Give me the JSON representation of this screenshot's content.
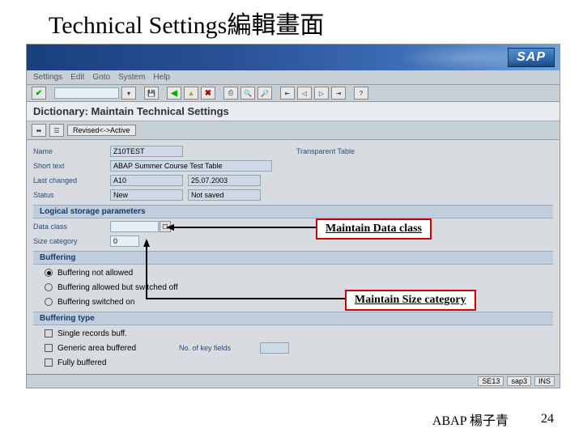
{
  "slide": {
    "title": "Technical Settings編輯畫面",
    "author": "ABAP 楊子青",
    "page": "24"
  },
  "sap": {
    "logo": "SAP",
    "menu": [
      "Settings",
      "Edit",
      "Goto",
      "System",
      "Help"
    ],
    "screen_title": "Dictionary: Maintain Technical Settings",
    "secondary": {
      "revised": "Revised<->Active"
    },
    "form": {
      "name_lbl": "Name",
      "name_val": "Z10TEST",
      "table_type": "Transparent Table",
      "short_lbl": "Short text",
      "short_val": "ABAP Summer Course Test Table",
      "changed_lbl": "Last changed",
      "changed_by": "A10",
      "changed_on": "25.07.2003",
      "status_lbl": "Status",
      "status_val": "New",
      "status2": "Not saved"
    },
    "storage": {
      "group": "Logical storage parameters",
      "data_class_lbl": "Data class",
      "size_cat_lbl": "Size category",
      "size_cat_val": "0"
    },
    "buffering": {
      "group": "Buffering",
      "opt1": "Buffering not allowed",
      "opt2": "Buffering allowed but switched off",
      "opt3": "Buffering switched on"
    },
    "buftype": {
      "group": "Buffering type",
      "opt1": "Single records buff.",
      "opt2": "Generic area buffered",
      "opt3": "Fully buffered",
      "keyfields_lbl": "No. of key fields"
    },
    "status": {
      "s1": "SE13",
      "s2": "sap3",
      "s3": "INS"
    }
  },
  "callouts": {
    "c1": "Maintain Data class",
    "c2": "Maintain Size category"
  }
}
